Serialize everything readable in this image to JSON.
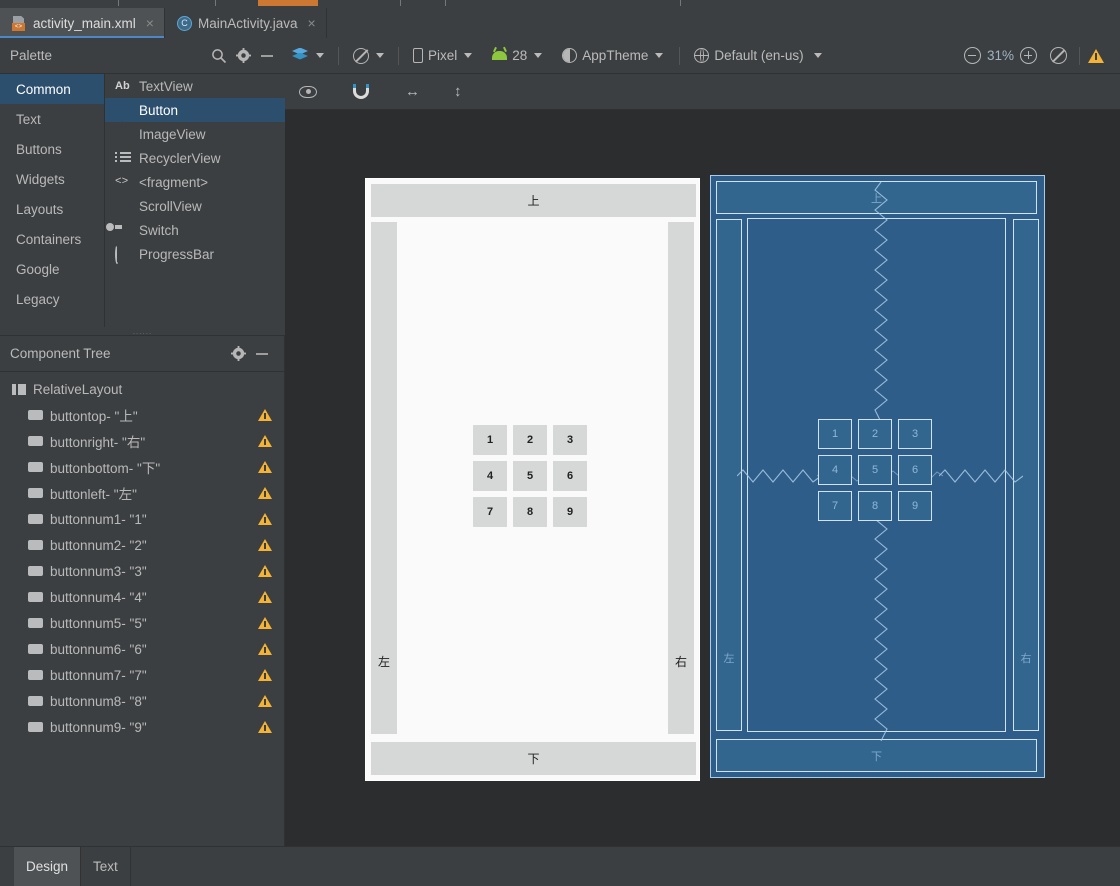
{
  "window": {
    "editor_tabs": [
      {
        "label": "activity_main.xml",
        "icon": "xml-file-icon",
        "active": true,
        "close": "×"
      },
      {
        "label": "MainActivity.java",
        "icon": "java-class-icon",
        "active": false,
        "close": "×"
      }
    ]
  },
  "palette": {
    "title": "Palette",
    "search_icon": "search-icon",
    "settings_icon": "gear-icon",
    "minimize_icon": "minimize-icon",
    "categories": [
      {
        "label": "Common",
        "active": true
      },
      {
        "label": "Text",
        "active": false
      },
      {
        "label": "Buttons",
        "active": false
      },
      {
        "label": "Widgets",
        "active": false
      },
      {
        "label": "Layouts",
        "active": false
      },
      {
        "label": "Containers",
        "active": false
      },
      {
        "label": "Google",
        "active": false
      },
      {
        "label": "Legacy",
        "active": false
      }
    ],
    "items": [
      {
        "label": "TextView",
        "icon": "textview-icon",
        "active": false
      },
      {
        "label": "Button",
        "icon": "button-icon",
        "active": true
      },
      {
        "label": "ImageView",
        "icon": "imageview-icon",
        "active": false
      },
      {
        "label": "RecyclerView",
        "icon": "recyclerview-icon",
        "active": false
      },
      {
        "label": "<fragment>",
        "icon": "fragment-icon",
        "active": false
      },
      {
        "label": "ScrollView",
        "icon": "scrollview-icon",
        "active": false
      },
      {
        "label": "Switch",
        "icon": "switch-icon",
        "active": false
      },
      {
        "label": "ProgressBar",
        "icon": "progressbar-icon",
        "active": false
      }
    ]
  },
  "toolbar": {
    "design_mode": {
      "label": "",
      "icon": "layers-icon"
    },
    "orientation": {
      "label": "",
      "icon": "rotate-icon"
    },
    "device": {
      "label": "Pixel",
      "icon": "device-icon"
    },
    "api_level": {
      "label": "28",
      "icon": "android-icon"
    },
    "theme": {
      "label": "AppTheme",
      "icon": "theme-icon"
    },
    "locale": {
      "label": "Default (en-us)",
      "icon": "globe-icon"
    },
    "zoom_out_icon": "zoom-out-icon",
    "zoom_level": "31%",
    "zoom_in_icon": "zoom-in-icon",
    "zoom_fit_icon": "zoom-disable-icon",
    "warning_icon": "warning-icon"
  },
  "design_toolbar": {
    "show_constraints": "eye-icon",
    "autoconnect": "magnet-icon",
    "horizontal_guideline": "↔",
    "vertical_guideline": "↕"
  },
  "component_tree": {
    "title": "Component Tree",
    "settings_icon": "gear-icon",
    "minimize_icon": "minimize-icon",
    "root": {
      "label": "RelativeLayout",
      "icon": "relativelayout-icon"
    },
    "children": [
      {
        "label": "buttontop- \"上\"",
        "icon": "button-icon",
        "warning": true
      },
      {
        "label": "buttonright- \"右\"",
        "icon": "button-icon",
        "warning": true
      },
      {
        "label": "buttonbottom- \"下\"",
        "icon": "button-icon",
        "warning": true
      },
      {
        "label": "buttonleft- \"左\"",
        "icon": "button-icon",
        "warning": true
      },
      {
        "label": "buttonnum1- \"1\"",
        "icon": "button-icon",
        "warning": true
      },
      {
        "label": "buttonnum2- \"2\"",
        "icon": "button-icon",
        "warning": true
      },
      {
        "label": "buttonnum3- \"3\"",
        "icon": "button-icon",
        "warning": true
      },
      {
        "label": "buttonnum4- \"4\"",
        "icon": "button-icon",
        "warning": true
      },
      {
        "label": "buttonnum5- \"5\"",
        "icon": "button-icon",
        "warning": true
      },
      {
        "label": "buttonnum6- \"6\"",
        "icon": "button-icon",
        "warning": true
      },
      {
        "label": "buttonnum7- \"7\"",
        "icon": "button-icon",
        "warning": true
      },
      {
        "label": "buttonnum8- \"8\"",
        "icon": "button-icon",
        "warning": true
      },
      {
        "label": "buttonnum9- \"9\"",
        "icon": "button-icon",
        "warning": true
      }
    ]
  },
  "preview": {
    "top_button": "上",
    "left_button": "左",
    "right_button": "右",
    "bottom_button": "下",
    "number_buttons": [
      "1",
      "2",
      "3",
      "4",
      "5",
      "6",
      "7",
      "8",
      "9"
    ]
  },
  "blueprint": {
    "top_button": "上",
    "left_button": "左",
    "right_button": "右",
    "bottom_button": "下",
    "number_buttons": [
      "1",
      "2",
      "3",
      "4",
      "5",
      "6",
      "7",
      "8",
      "9"
    ]
  },
  "bottom_tabs": [
    {
      "label": "Design",
      "active": true
    },
    {
      "label": "Text",
      "active": false
    }
  ],
  "colors": {
    "accent": "#4a88c7",
    "panel_bg": "#3c3f41",
    "selection_bg": "#2d4f6e",
    "surface_bg": "#2b2d2e",
    "blueprint_bg": "#2f5d8a",
    "blueprint_stroke": "#cfe3f5",
    "warning": "#f5b335",
    "xml_badge": "#cc7832",
    "android_green": "#8dc63f"
  }
}
